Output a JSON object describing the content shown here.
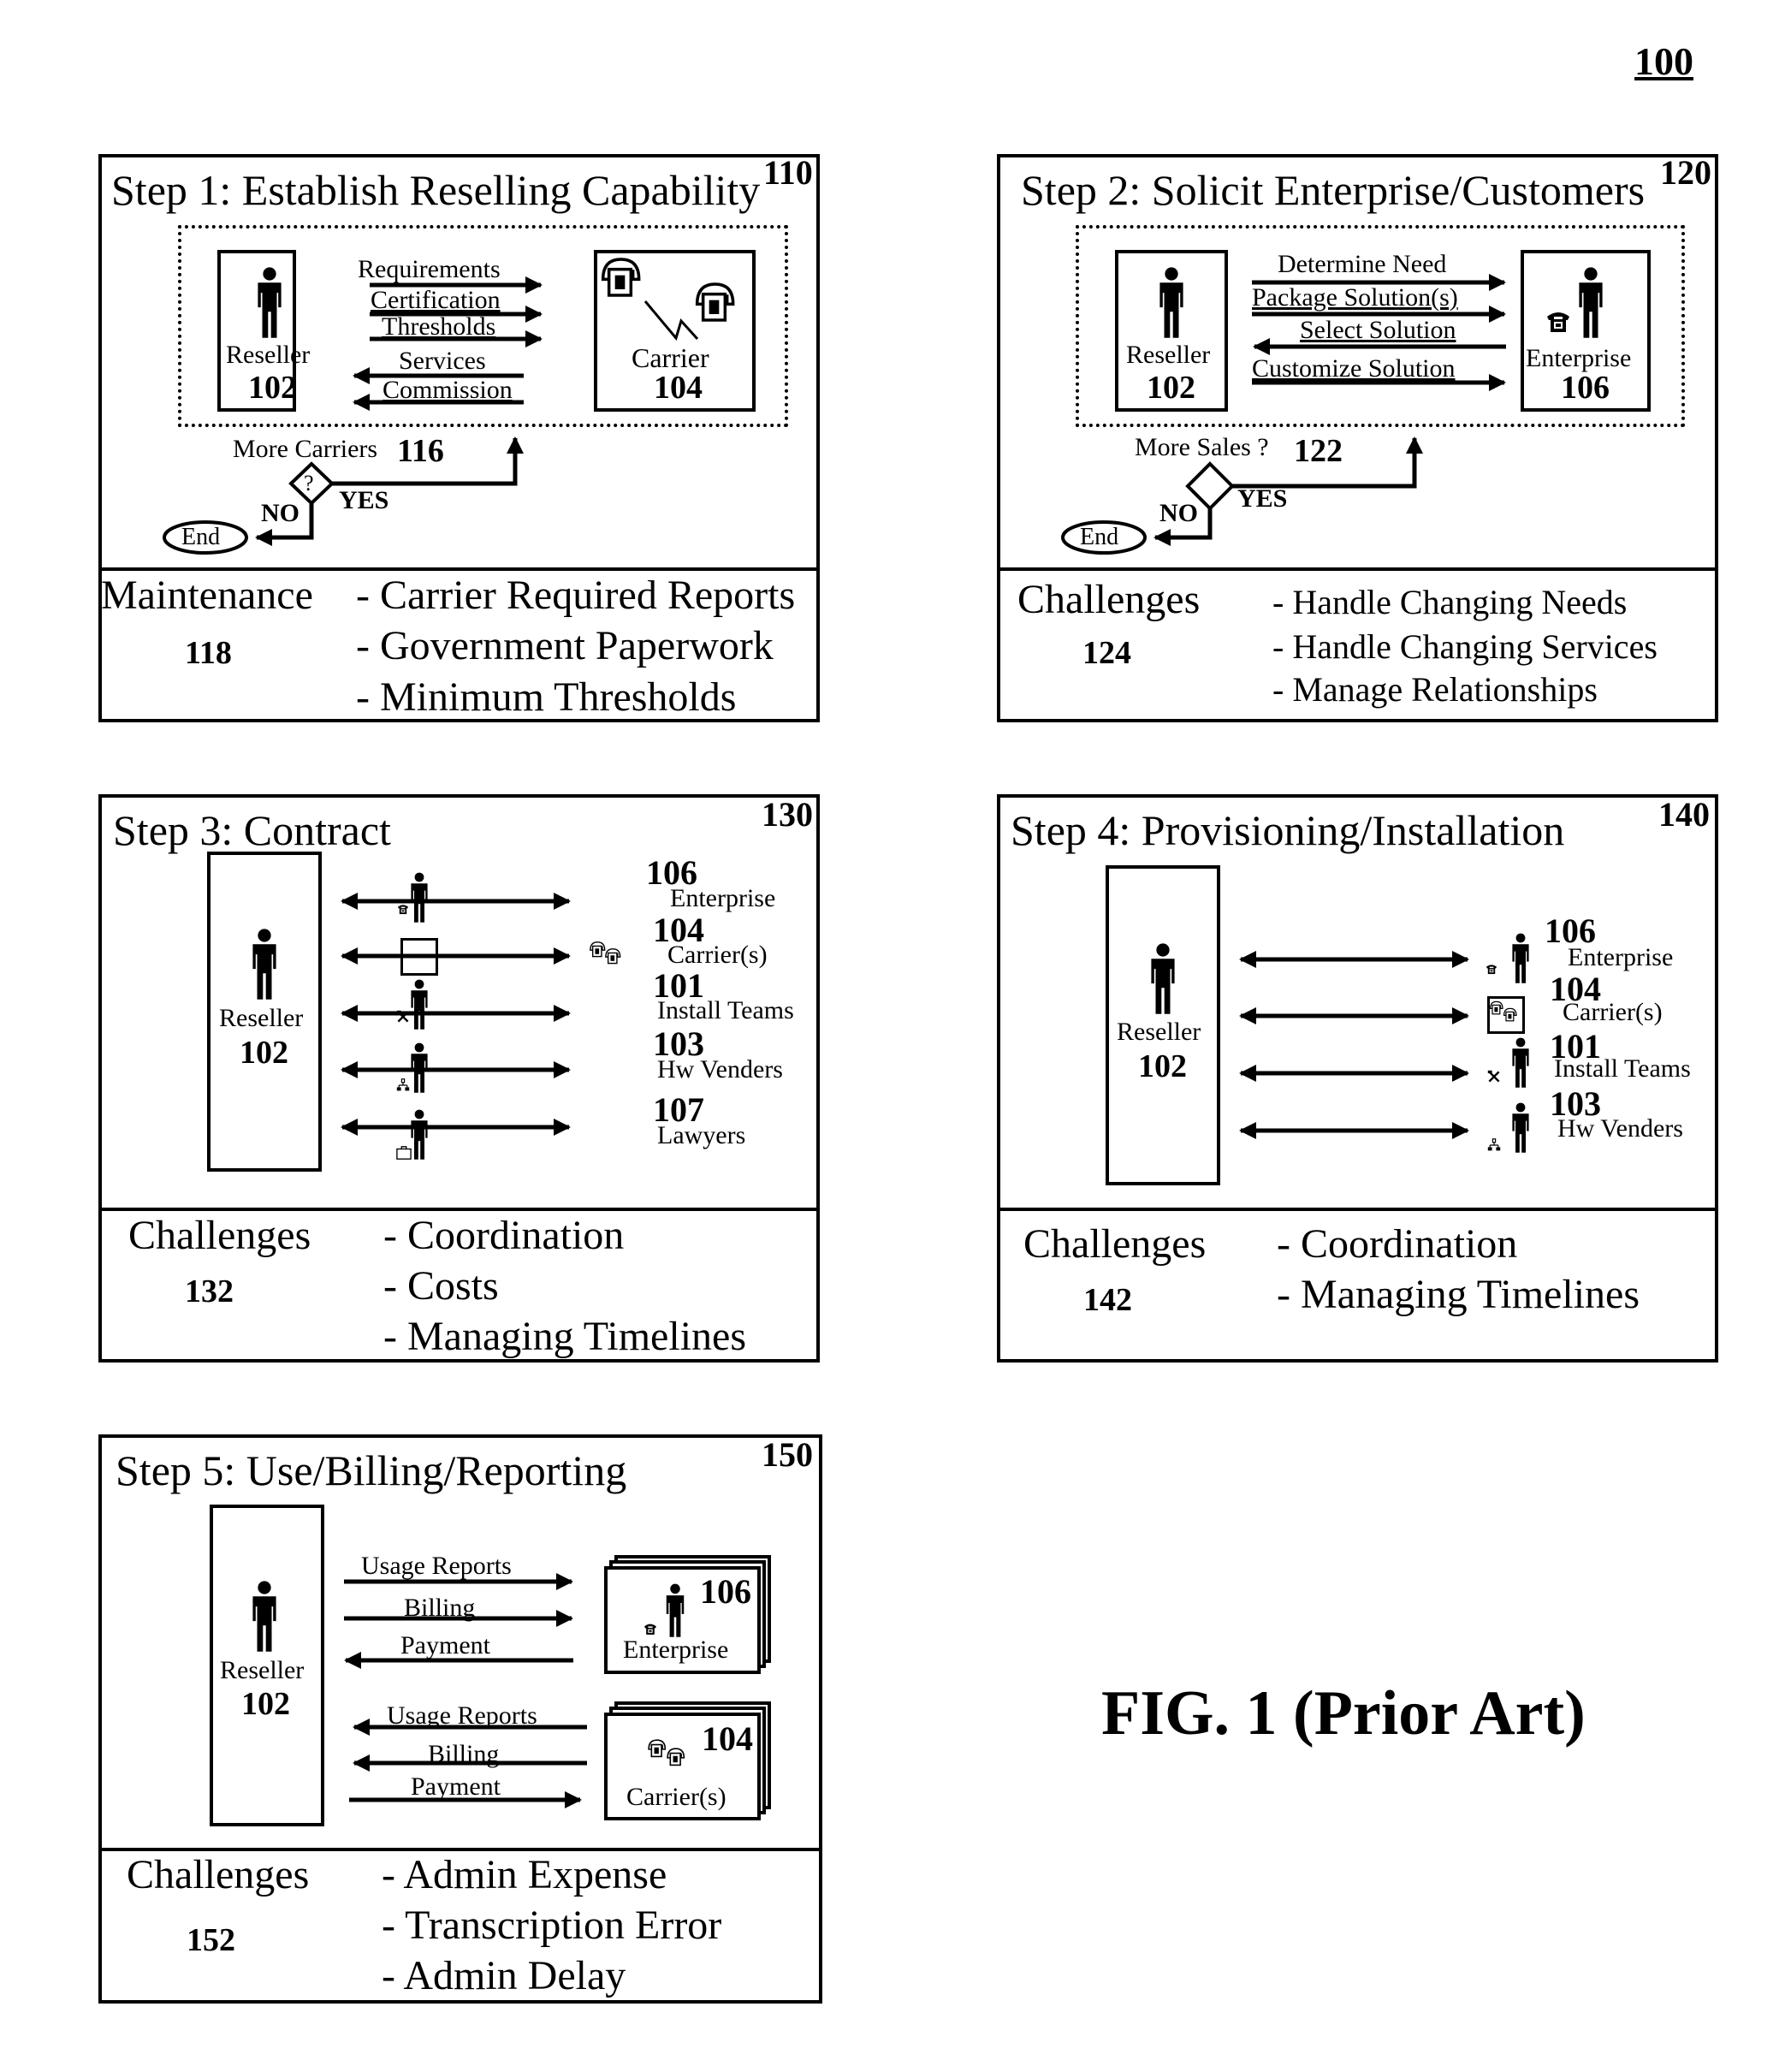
{
  "page_ref": "100",
  "figure_caption": "FIG. 1 (Prior Art)",
  "step1": {
    "title": "Step 1: Establish Reselling Capability",
    "ref": "110",
    "reseller": {
      "label": "Reseller",
      "ref": "102"
    },
    "carrier": {
      "label": "Carrier",
      "ref": "104"
    },
    "arrows_to_carrier": [
      "Requirements",
      "Certification",
      "Thresholds"
    ],
    "arrows_to_reseller": [
      "Services",
      "Commission"
    ],
    "decision": {
      "label": "More Carriers",
      "ref": "116",
      "symbol": "?",
      "yes": "YES",
      "no": "NO",
      "end": "End"
    },
    "section": {
      "heading": "Maintenance",
      "ref": "118",
      "items": [
        "- Carrier Required Reports",
        "- Government Paperwork",
        "- Minimum Thresholds"
      ]
    }
  },
  "step2": {
    "title": "Step 2: Solicit Enterprise/Customers",
    "ref": "120",
    "reseller": {
      "label": "Reseller",
      "ref": "102"
    },
    "enterprise": {
      "label": "Enterprise",
      "ref": "106"
    },
    "messages": [
      {
        "label": "Determine Need",
        "direction": "to-enterprise"
      },
      {
        "label": "Package Solution(s)",
        "direction": "to-enterprise"
      },
      {
        "label": "Select Solution",
        "direction": "to-reseller"
      },
      {
        "label": "Customize Solution",
        "direction": "to-enterprise"
      }
    ],
    "decision": {
      "label": "More Sales ?",
      "ref": "122",
      "yes": "YES",
      "no": "NO",
      "end": "End"
    },
    "section": {
      "heading": "Challenges",
      "ref": "124",
      "items": [
        "- Handle Changing Needs",
        "- Handle Changing Services",
        "- Manage Relationships"
      ]
    }
  },
  "step3": {
    "title": "Step 3: Contract",
    "ref": "130",
    "reseller": {
      "label": "Reseller",
      "ref": "102"
    },
    "parties": [
      {
        "ref": "106",
        "label": "Enterprise",
        "icon": "phone"
      },
      {
        "ref": "104",
        "label": "Carrier(s)",
        "icon": "carrier"
      },
      {
        "ref": "101",
        "label": "Install Teams",
        "icon": "tools"
      },
      {
        "ref": "103",
        "label": "Hw Venders",
        "icon": "network"
      },
      {
        "ref": "107",
        "label": "Lawyers",
        "icon": "briefcase"
      }
    ],
    "section": {
      "heading": "Challenges",
      "ref": "132",
      "items": [
        "- Coordination",
        "- Costs",
        "- Managing Timelines"
      ]
    }
  },
  "step4": {
    "title": "Step 4: Provisioning/Installation",
    "ref": "140",
    "reseller": {
      "label": "Reseller",
      "ref": "102"
    },
    "parties": [
      {
        "ref": "106",
        "label": "Enterprise",
        "icon": "phone"
      },
      {
        "ref": "104",
        "label": "Carrier(s)",
        "icon": "carrier"
      },
      {
        "ref": "101",
        "label": "Install Teams",
        "icon": "tools"
      },
      {
        "ref": "103",
        "label": "Hw Venders",
        "icon": "network"
      }
    ],
    "section": {
      "heading": "Challenges",
      "ref": "142",
      "items": [
        "- Coordination",
        "- Managing Timelines"
      ]
    }
  },
  "step5": {
    "title": "Step 5: Use/Billing/Reporting",
    "ref": "150",
    "reseller": {
      "label": "Reseller",
      "ref": "102"
    },
    "enterprise": {
      "label": "Enterprise",
      "ref": "106"
    },
    "carrier": {
      "label": "Carrier(s)",
      "ref": "104"
    },
    "enterprise_messages": [
      {
        "label": "Usage Reports",
        "direction": "to-enterprise"
      },
      {
        "label": "Billing",
        "direction": "to-enterprise"
      },
      {
        "label": "Payment",
        "direction": "to-reseller"
      }
    ],
    "carrier_messages": [
      {
        "label": "Usage Reports",
        "direction": "to-reseller"
      },
      {
        "label": "Billing",
        "direction": "to-reseller"
      },
      {
        "label": "Payment",
        "direction": "to-carrier"
      }
    ],
    "section": {
      "heading": "Challenges",
      "ref": "152",
      "items": [
        "- Admin Expense",
        "- Transcription Error",
        "- Admin Delay"
      ]
    }
  }
}
